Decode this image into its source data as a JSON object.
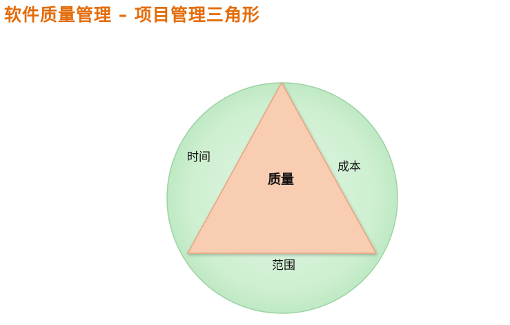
{
  "slide": {
    "title": "软件质量管理 – 项目管理三角形"
  },
  "diagram": {
    "center_label": "质量",
    "left_label": "时间",
    "right_label": "成本",
    "bottom_label": "范围"
  },
  "colors": {
    "title": "#E36C09",
    "circle_fill": "#C9EDCC",
    "circle_stroke": "#9DD3A3",
    "triangle_fill": "#F9CDB2",
    "triangle_stroke": "#E8A47E",
    "label_text": "#111111"
  }
}
